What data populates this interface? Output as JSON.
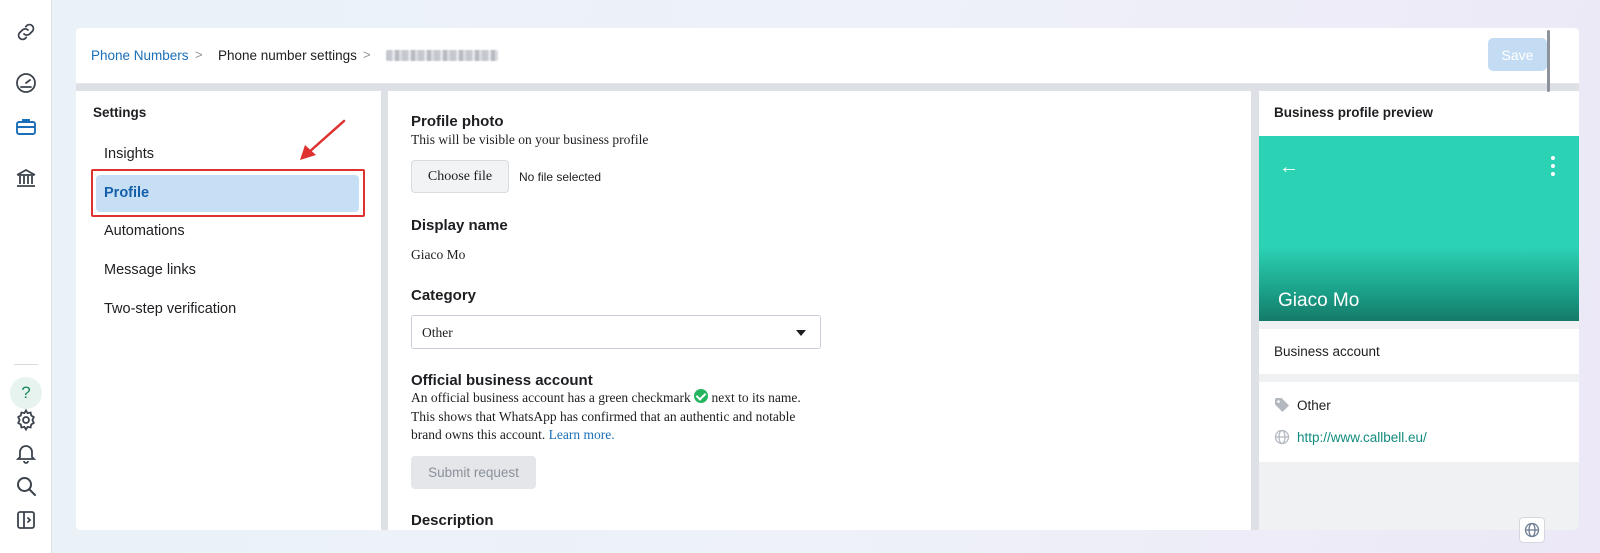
{
  "rail": {
    "icons": [
      "link-icon",
      "dashboard-gauge-icon",
      "briefcase-icon",
      "bank-icon",
      "help-icon",
      "settings-gear-icon",
      "bell-icon",
      "search-icon",
      "sidebar-toggle-icon"
    ],
    "help_label": "?"
  },
  "breadcrumb": {
    "link": "Phone Numbers",
    "current": "Phone number settings",
    "sep": ">"
  },
  "toolbar": {
    "save_label": "Save"
  },
  "settings": {
    "title": "Settings",
    "items": [
      {
        "label": "Insights",
        "active": false
      },
      {
        "label": "Profile",
        "active": true
      },
      {
        "label": "Automations",
        "active": false
      },
      {
        "label": "Message links",
        "active": false
      },
      {
        "label": "Two-step verification",
        "active": false
      }
    ]
  },
  "profile": {
    "photo_title": "Profile photo",
    "photo_desc": "This will be visible on your business profile",
    "choose_file": "Choose file",
    "no_file": "No file selected",
    "display_name_title": "Display name",
    "display_name_value": "Giaco Mo",
    "category_title": "Category",
    "category_value": "Other",
    "official_title": "Official business account",
    "official_desc_1": "An official business account has a green checkmark",
    "official_desc_2": "next to its name.",
    "official_desc_3": "This shows that WhatsApp has confirmed that an authentic and notable",
    "official_desc_4": "brand owns this account.",
    "learn_more": "Learn more.",
    "submit_request": "Submit request",
    "description_title": "Description"
  },
  "preview": {
    "title": "Business profile preview",
    "name": "Giaco Mo",
    "account_type": "Business account",
    "category": "Other",
    "website": "http://www.callbell.eu/"
  },
  "colors": {
    "accent": "#1a6fb8",
    "active_bg": "#c7dff5",
    "hero": "#2cd2b4",
    "highlight": "#e03131",
    "check": "#25b55f"
  }
}
